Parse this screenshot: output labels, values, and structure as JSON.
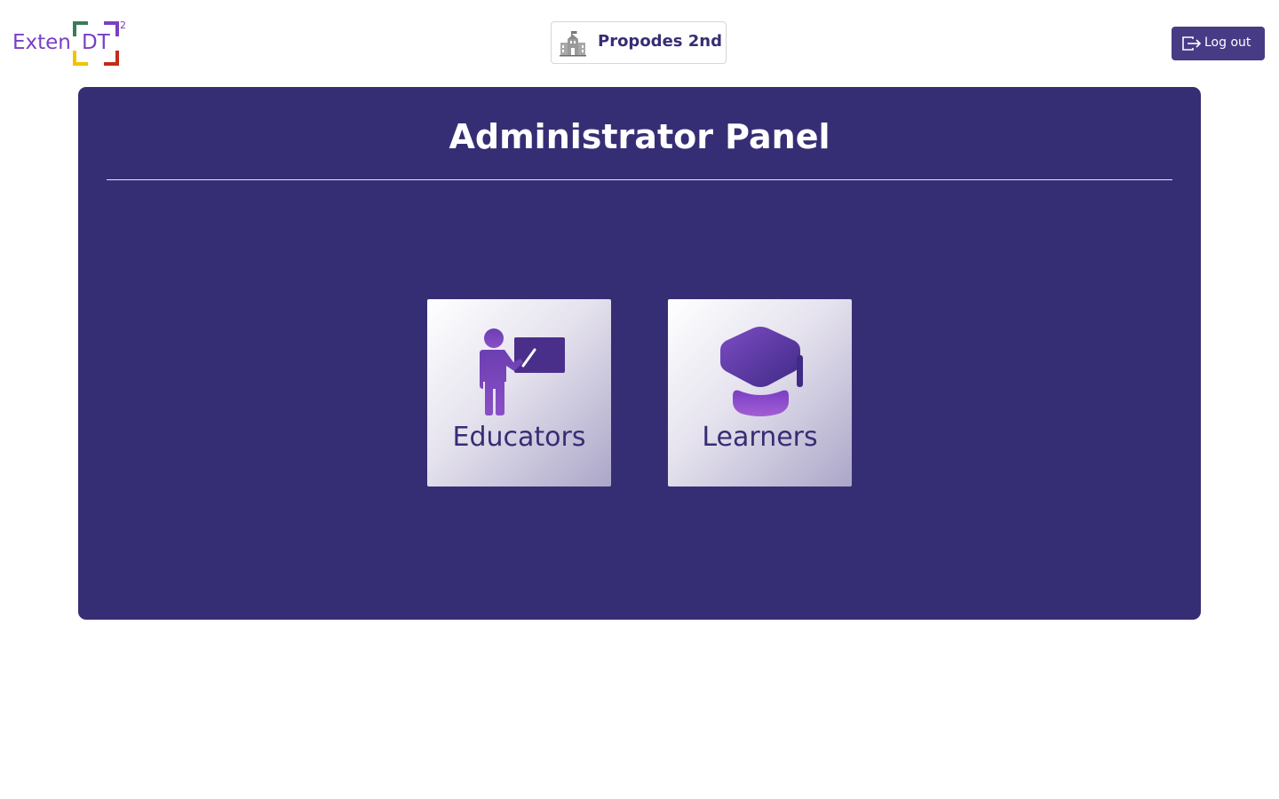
{
  "header": {
    "logo": {
      "text_left": "Exten",
      "text_mid": "DT",
      "superscript": "2",
      "colors": {
        "text": "#7a3fc4",
        "top_left": "#3b7a5a",
        "top_right": "#7a3fc4",
        "bottom_left": "#f0c400",
        "bottom_right": "#c52a1a"
      }
    },
    "school": {
      "icon": "school-building-icon",
      "name": "Propodes 2nd"
    },
    "logout": {
      "icon": "logout-icon",
      "label": "Log out"
    }
  },
  "panel": {
    "title": "Administrator Panel",
    "background_color": "#362e74",
    "tiles": [
      {
        "icon": "teacher-board-icon",
        "label": "Educators"
      },
      {
        "icon": "graduation-cap-icon",
        "label": "Learners"
      }
    ]
  }
}
